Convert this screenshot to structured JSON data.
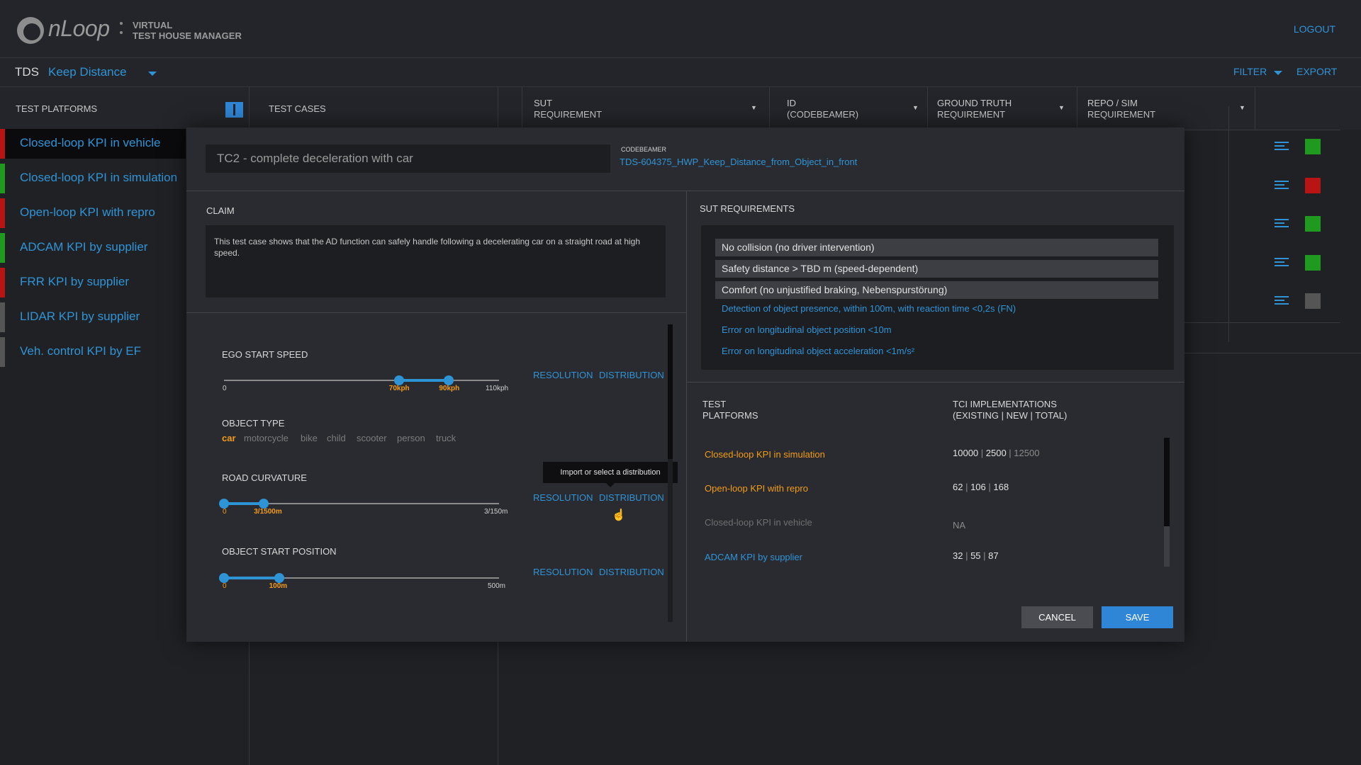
{
  "header": {
    "logo_text": "nLoop",
    "app_title_line1": "VIRTUAL",
    "app_title_line2": "TEST HOUSE MANAGER",
    "logout": "LOGOUT"
  },
  "tds": {
    "label": "TDS",
    "value": "Keep Distance",
    "filter": "FILTER",
    "export": "EXPORT"
  },
  "columns": {
    "test_platforms": "TEST PLATFORMS",
    "test_cases": "TEST CASES",
    "sut_requirement": [
      "SUT",
      "REQUIREMENT"
    ],
    "id": [
      "ID",
      "(CODEBEAMER)"
    ],
    "ground_truth": [
      "GROUND TRUTH",
      "REQUIREMENT"
    ],
    "repo_sim": [
      "REPO / SIM",
      "REQUIREMENT"
    ]
  },
  "sidebar": {
    "platforms": [
      {
        "label": "Closed-loop KPI in vehicle",
        "color": "#b81414",
        "selected": true
      },
      {
        "label": "Closed-loop KPI in simulation",
        "color": "#1f9a1f",
        "selected": false
      },
      {
        "label": "Open-loop KPI with repro",
        "color": "#b81414",
        "selected": false
      },
      {
        "label": "ADCAM KPI by supplier",
        "color": "#1f9a1f",
        "selected": false
      },
      {
        "label": "FRR KPI by supplier",
        "color": "#b81414",
        "selected": false
      },
      {
        "label": "LIDAR KPI by supplier",
        "color": "#555555",
        "selected": false
      },
      {
        "label": "Veh. control KPI by EF",
        "color": "#555555",
        "selected": false
      }
    ]
  },
  "status_rows": [
    "#1f9a1f",
    "#b81414",
    "#1f9a1f",
    "#1f9a1f",
    "#555555"
  ],
  "dialog": {
    "test_case_name": "TC2 - complete deceleration with car",
    "codebeamer_label": "CODEBEAMER",
    "codebeamer_link": "TDS-604375_HWP_Keep_Distance_from_Object_in_front",
    "claim_title": "CLAIM",
    "claim_text": "This test case shows that the AD function can safely handle following a decelerating car on a straight road at high speed.",
    "resolution": "RESOLUTION",
    "distribution": "DISTRIBUTION",
    "tooltip": "Import or select a distribution",
    "ego_speed": {
      "title": "EGO START SPEED",
      "min": "0",
      "max": "110kph",
      "low": "70kph",
      "high": "90kph",
      "low_frac": 0.636,
      "high_frac": 0.818
    },
    "object_type": {
      "title": "OBJECT TYPE",
      "options": [
        "car",
        "motorcycle",
        "bike",
        "child",
        "scooter",
        "person",
        "truck"
      ],
      "selected": "car"
    },
    "road_curvature": {
      "title": "ROAD CURVATURE",
      "min": "0",
      "max": "3/150m",
      "high": "3/1500m",
      "high_frac": 0.145
    },
    "object_start": {
      "title": "OBJECT START POSITION",
      "min": "0",
      "max": "500m",
      "high": "100m",
      "high_frac": 0.2
    },
    "sut_title": "SUT REQUIREMENTS",
    "sut_selected": [
      "No collision (no driver intervention)",
      "Safety distance > TBD m (speed-dependent)",
      "Comfort (no unjustified braking, Nebenspurstörung)"
    ],
    "sut_links": [
      "Detection of object presence, within 100m, with reaction time <0,2s (FN)",
      "Error on longitudinal object position <10m",
      "Error on longitudinal object acceleration <1m/s²"
    ],
    "tp_header": [
      "TEST",
      "PLATFORMS"
    ],
    "tci_header": [
      "TCI IMPLEMENTATIONS",
      "(EXISTING | NEW | TOTAL)"
    ],
    "tp_rows": [
      {
        "name": "Closed-loop KPI in simulation",
        "existing": "10000",
        "new": "2500",
        "total": "12500",
        "state": "orange"
      },
      {
        "name": "Open-loop KPI with repro",
        "existing": "62",
        "new": "106",
        "total": "168",
        "state": "orange"
      },
      {
        "name": "Closed-loop KPI in vehicle",
        "na": "NA",
        "state": "muted"
      },
      {
        "name": "ADCAM KPI by supplier",
        "existing": "32",
        "new": "55",
        "total": "87",
        "state": "blue"
      }
    ],
    "cancel": "CANCEL",
    "save": "SAVE"
  }
}
